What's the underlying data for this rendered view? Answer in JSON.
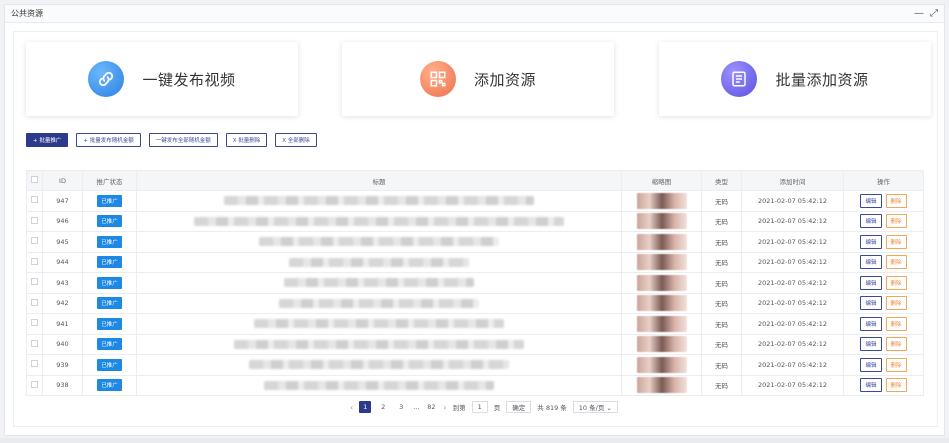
{
  "window": {
    "title": "公共资源",
    "minimize": "—",
    "maximize": "⤢"
  },
  "cards": [
    {
      "label": "一键发布视频",
      "icon": "link-icon",
      "color": "#3b8de8"
    },
    {
      "label": "添加资源",
      "icon": "qrcode-icon",
      "color": "#f07f5a"
    },
    {
      "label": "批量添加资源",
      "icon": "list-form-icon",
      "color": "#6a5fe6"
    }
  ],
  "toolbar": {
    "batch_promote": "+ 批量推广",
    "batch_publish_random": "+ 批量发布随机金额",
    "publish_all_random": "一键发布全部随机金额",
    "batch_delete": "X 批量删除",
    "delete_all": "X 全部删除"
  },
  "table": {
    "headers": [
      "",
      "ID",
      "推广状态",
      "标题",
      "缩略图",
      "类型",
      "添加时间",
      "操作"
    ],
    "rows": [
      {
        "id": "947",
        "status": "已推广",
        "type": "无码",
        "time": "2021-02-07 05:42:12"
      },
      {
        "id": "946",
        "status": "已推广",
        "type": "无码",
        "time": "2021-02-07 05:42:12"
      },
      {
        "id": "945",
        "status": "已推广",
        "type": "无码",
        "time": "2021-02-07 05:42:12"
      },
      {
        "id": "944",
        "status": "已推广",
        "type": "无码",
        "time": "2021-02-07 05:42:12"
      },
      {
        "id": "943",
        "status": "已推广",
        "type": "无码",
        "time": "2021-02-07 05:42:12"
      },
      {
        "id": "942",
        "status": "已推广",
        "type": "无码",
        "time": "2021-02-07 05:42:12"
      },
      {
        "id": "941",
        "status": "已推广",
        "type": "无码",
        "time": "2021-02-07 05:42:12"
      },
      {
        "id": "940",
        "status": "已推广",
        "type": "无码",
        "time": "2021-02-07 05:42:12"
      },
      {
        "id": "939",
        "status": "已推广",
        "type": "无码",
        "time": "2021-02-07 05:42:12"
      },
      {
        "id": "938",
        "status": "已推广",
        "type": "无码",
        "time": "2021-02-07 05:42:12"
      }
    ],
    "edit_label": "编辑",
    "delete_label": "删除"
  },
  "pager": {
    "prev": "‹",
    "pages": [
      "1",
      "2",
      "3",
      "...",
      "82"
    ],
    "next": "›",
    "goto_label": "到第",
    "goto_value": "1",
    "page_unit": "页",
    "confirm": "确定",
    "total": "共 819 条",
    "page_size": "10 条/页 ⌄"
  }
}
